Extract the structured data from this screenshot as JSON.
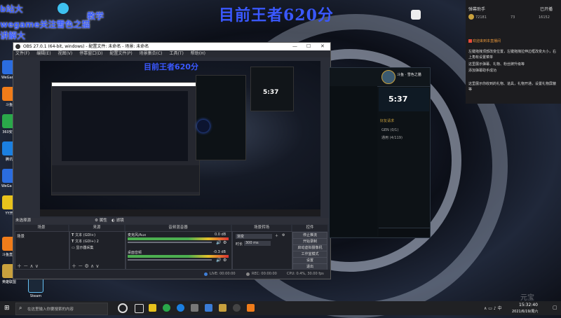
{
  "overlay": {
    "title": "目前王者620分",
    "line1": "b站大",
    "line2": "教学",
    "line3": "wegame关注雪色之猫",
    "line4": "讲解大"
  },
  "desktop_icons": [
    {
      "label": "WeGame",
      "color": "#2b6de0"
    },
    {
      "label": "斗鱼",
      "color": "#f07c1a"
    },
    {
      "label": "360安全",
      "color": "#2aa84a"
    },
    {
      "label": "腾讯",
      "color": "#1b7fe0"
    },
    {
      "label": "WeGa elup3",
      "color": "#2b6de0"
    },
    {
      "label": "YY开",
      "color": "#e8c21c"
    },
    {
      "label": "斗鱼直播",
      "color": "#f07c1a"
    },
    {
      "label": "英雄联盟",
      "color": "#c9a13d"
    },
    {
      "label": "Steam",
      "color": "#1b2838"
    }
  ],
  "obs": {
    "title": "OBS 27.0.1 (64-bit, windows) - 配置文件: 未命名 - 场景: 未命名",
    "menu": [
      "文件(F)",
      "编辑(E)",
      "视图(V)",
      "停靠窗口(D)",
      "配置文件(P)",
      "场景集合(C)",
      "工具(T)",
      "帮助(H)"
    ],
    "no_source": "未选择源",
    "properties": "属性",
    "filters": "滤镜",
    "docks": {
      "scenes": "场景",
      "sources": "来源",
      "mixer": "音频混音器",
      "transitions": "场景转场",
      "controls": "控件"
    },
    "scenes_list": [
      "场景"
    ],
    "sources_list": [
      "文本 (GDI+)",
      "文本 (GDI+) 2",
      "显示器采集"
    ],
    "mixer": [
      {
        "name": "麦克风/Aux",
        "level": "0.0 dB"
      },
      {
        "name": "桌面音频",
        "level": "-0.3 dB"
      }
    ],
    "transition_type": "渐变",
    "duration_label": "时长",
    "duration_value": "300 ms",
    "controls": [
      "停止推流",
      "开始录制",
      "启动虚拟摄像机",
      "工作室模式",
      "设置",
      "退出"
    ],
    "status": {
      "live": "LIVE: 00:00:00",
      "rec": "REC: 00:00:00",
      "cpu": "CPU: 0.4%, 30.00 fps"
    }
  },
  "lol_client": {
    "name": "斗鱼 · 雪色之猫",
    "timer": "5:37",
    "friends_header": "好友请求",
    "group1": "GEN (0/1)",
    "group2": "通用 (4/119)"
  },
  "chat": {
    "header": "弹幕助手",
    "online_count": "已开播",
    "stats": [
      "72181",
      "73",
      "16152"
    ],
    "notice": "欢迎来到本直播间",
    "message1": "左键拖拽顶部改变位置，左键拖拽拉伸边框改变大小，右上角有设置菜单",
    "message2": "这里展示弹幕、礼物、粉丝牌升级等",
    "message3": "添加弹幕助手成功",
    "message4": "这里展示你收到的礼物、道具，礼物开通，设置礼物屏蔽等"
  },
  "taskbar": {
    "search_placeholder": "在这里输入你要搜索的内容",
    "time": "15:32:40",
    "date": "2021/6/19/周六"
  },
  "watermark": "元宝"
}
